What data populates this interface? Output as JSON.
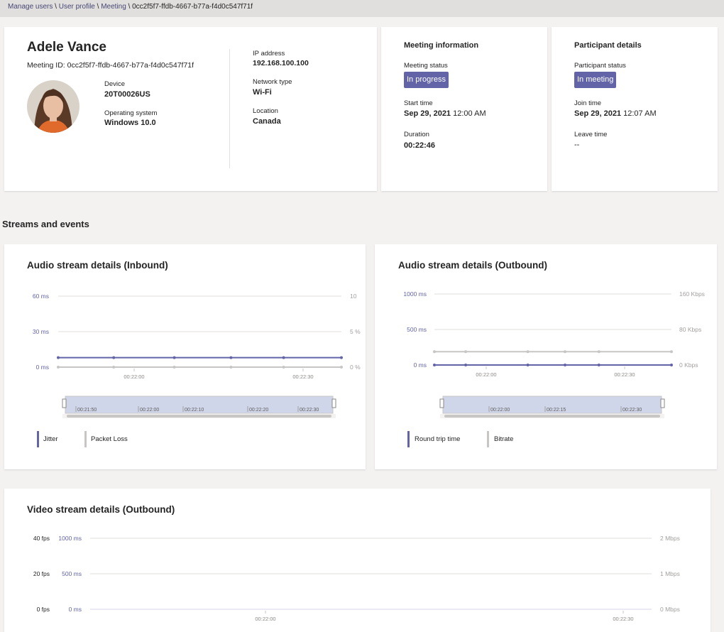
{
  "breadcrumb": {
    "items": [
      "Manage users",
      "User profile",
      "Meeting"
    ],
    "current": "0cc2f5f7-ffdb-4667-b77a-f4d0c547f71f",
    "separator": "\\"
  },
  "user": {
    "name": "Adele Vance",
    "meeting_id": "Meeting ID: 0cc2f5f7-ffdb-4667-b77a-f4d0c547f71f",
    "device_label": "Device",
    "device": "20T00026US",
    "os_label": "Operating system",
    "os": "Windows 10.0",
    "ip_label": "IP address",
    "ip": "192.168.100.100",
    "network_label": "Network type",
    "network": "Wi-Fi",
    "location_label": "Location",
    "location": "Canada"
  },
  "meeting_info": {
    "title": "Meeting information",
    "status_label": "Meeting status",
    "status": "In progress",
    "start_label": "Start time",
    "start_date": "Sep 29, 2021",
    "start_time": "12:00 AM",
    "duration_label": "Duration",
    "duration": "00:22:46"
  },
  "participant": {
    "title": "Participant details",
    "status_label": "Participant status",
    "status": "In meeting",
    "join_label": "Join time",
    "join_date": "Sep 29, 2021",
    "join_time": "12:07 AM",
    "leave_label": "Leave time",
    "leave": "--"
  },
  "streams_title": "Streams and events",
  "colors": {
    "primary": "#6264a7",
    "secondary": "#c8c6c4",
    "badge": "#6264a7"
  },
  "chart_data": [
    {
      "type": "line",
      "title": "Audio stream details (Inbound)",
      "left_ticks": [
        "60 ms",
        "30 ms",
        "0 ms"
      ],
      "right_ticks": [
        "10",
        "5 %",
        "0 %"
      ],
      "x_ticks": [
        "00:22:00",
        "00:22:30"
      ],
      "navigator_ticks": [
        "00:21:50",
        "00:22:00",
        "00:22:10",
        "00:22:20",
        "00:22:30"
      ],
      "ylim_left": [
        0,
        60
      ],
      "ylim_right": [
        0,
        10
      ],
      "series": [
        {
          "name": "Jitter",
          "axis": "left",
          "color": "#6264a7",
          "values": [
            8,
            8,
            8,
            8,
            8,
            8
          ]
        },
        {
          "name": "Packet Loss",
          "axis": "right",
          "color": "#c8c6c4",
          "values": [
            0,
            0,
            0,
            0,
            0,
            0
          ]
        }
      ]
    },
    {
      "type": "line",
      "title": "Audio stream details (Outbound)",
      "left_ticks": [
        "1000 ms",
        "500 ms",
        "0 ms"
      ],
      "right_ticks": [
        "160 Kbps",
        "80 Kbps",
        "0 Kbps"
      ],
      "x_ticks": [
        "00:22:00",
        "00:22:30"
      ],
      "navigator_ticks": [
        "00:22:00",
        "00:22:15",
        "00:22:30"
      ],
      "ylim_left": [
        0,
        1000
      ],
      "ylim_right": [
        0,
        160
      ],
      "series": [
        {
          "name": "Round trip time",
          "axis": "left",
          "color": "#6264a7",
          "values": [
            0,
            0,
            0,
            0,
            0,
            0
          ]
        },
        {
          "name": "Bitrate",
          "axis": "right",
          "color": "#c8c6c4",
          "values": [
            30,
            30,
            30,
            30,
            30,
            30
          ]
        }
      ]
    },
    {
      "type": "line",
      "title": "Video stream details (Outbound)",
      "left_ticks": [
        "40 fps",
        "20 fps",
        "0 fps"
      ],
      "mid_ticks": [
        "1000 ms",
        "500 ms",
        "0 ms"
      ],
      "right_ticks": [
        "2 Mbps",
        "1 Mbps",
        "0 Mbps"
      ],
      "x_ticks": [
        "00:22:00",
        "00:22:30"
      ],
      "series": []
    }
  ]
}
